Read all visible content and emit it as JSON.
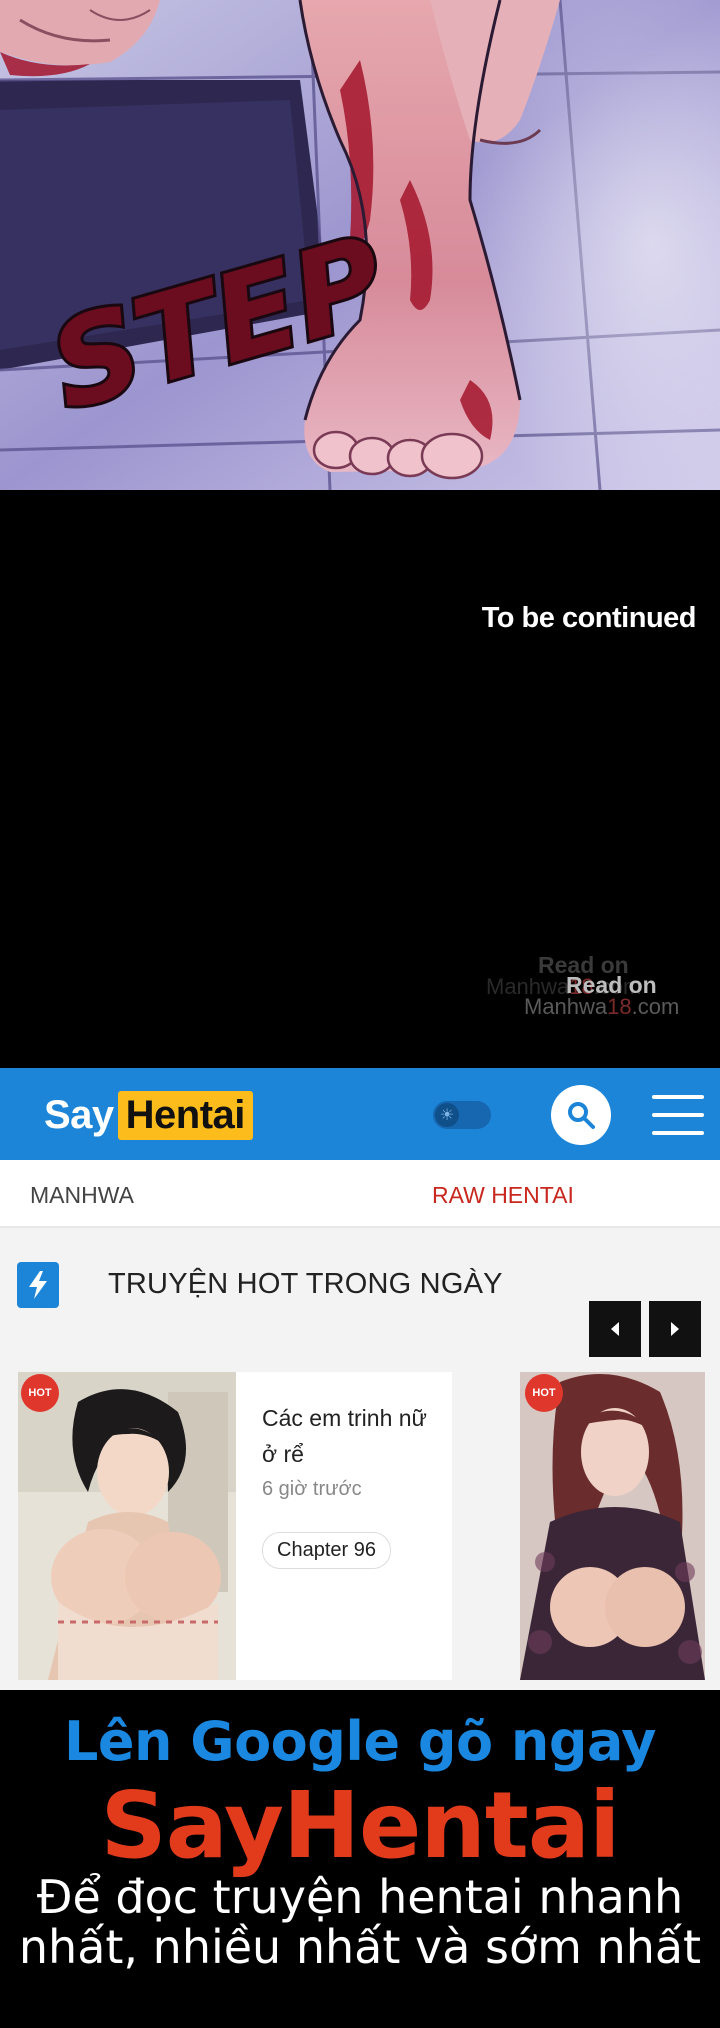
{
  "comic": {
    "sfx_text": "STEP",
    "caption": "To be continued"
  },
  "watermark": {
    "line_a": "Read on",
    "line_b": "Read on",
    "line_c_prefix": "Manhwa",
    "line_c_accent": "18",
    "line_c_suffix": ".com",
    "line_d_prefix": "Manhwa",
    "line_d_accent": "18",
    "line_d_suffix": ".com"
  },
  "header": {
    "logo_say": "Say",
    "logo_hentai": "Hentai",
    "theme_icon": "sun-icon",
    "search_icon": "search-icon",
    "menu_icon": "hamburger-menu-icon",
    "brand_color": "#1c85d8",
    "logo_accent": "#fcbc1c"
  },
  "nav": {
    "items": [
      {
        "label": "MANHWA",
        "color": "#444444"
      },
      {
        "label": "RAW HENTAI",
        "color": "#c8281e"
      }
    ]
  },
  "hot_section": {
    "title": "TRUYỆN HOT TRONG NGÀY",
    "icon": "lightning-icon",
    "prev_icon": "chevron-left-icon",
    "next_icon": "chevron-right-icon",
    "cards": [
      {
        "badge": "HOT",
        "title": "Các em trinh nữ ở rể",
        "time": "6 giờ trước",
        "chapter": "Chapter 96"
      },
      {
        "badge": "HOT"
      }
    ]
  },
  "promo": {
    "line1": "Lên Google gõ ngay",
    "brand": "SayHentai",
    "body": "Để đọc truyện hentai nhanh nhất, nhiều nhất và sớm nhất",
    "line1_color": "#1a88e0",
    "brand_color": "#e23b1c"
  }
}
